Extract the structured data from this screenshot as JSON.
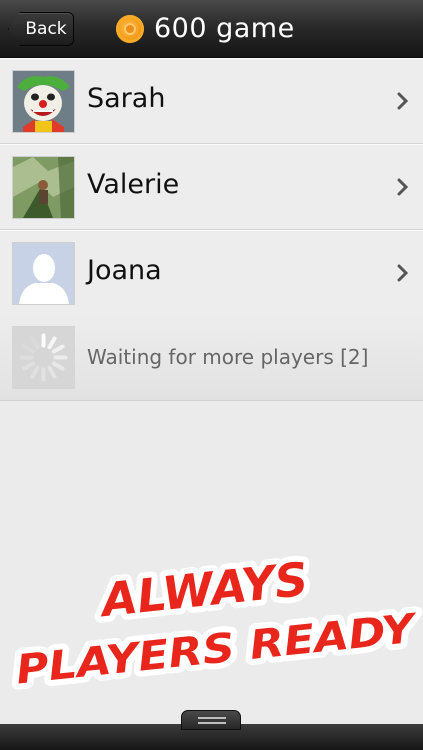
{
  "header": {
    "back_label": "Back",
    "title": "600 game",
    "icons": {
      "back": "back-arrow-icon",
      "coin": "coin-icon"
    }
  },
  "players": [
    {
      "name": "Sarah",
      "avatar": "clown-avatar"
    },
    {
      "name": "Valerie",
      "avatar": "nature-avatar"
    },
    {
      "name": "Joana",
      "avatar": "default-avatar"
    }
  ],
  "waiting": {
    "text": "Waiting for more players [2]",
    "icon": "spinner-icon"
  },
  "promo": {
    "line1": "ALWAYS",
    "line2": "PLAYERS READY",
    "fill_color": "#e8261c",
    "outline_color": "#ffffff"
  },
  "colors": {
    "topbar": "#2a2a2a",
    "list_bg": "#ededed"
  }
}
